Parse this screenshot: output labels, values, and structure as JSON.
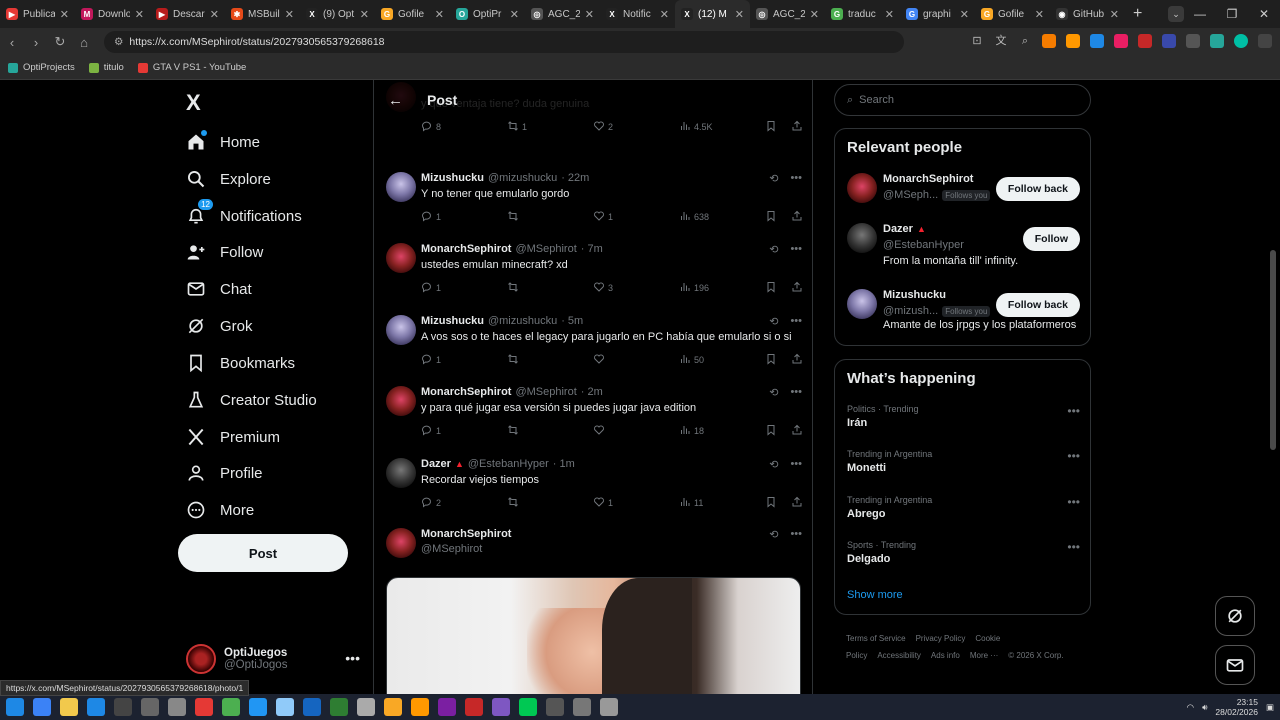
{
  "browser": {
    "tabs": [
      {
        "label": "Publica",
        "color": "#e53935",
        "glyph": "▶"
      },
      {
        "label": "Downlo",
        "color": "#c2185b",
        "glyph": "M"
      },
      {
        "label": "Descar",
        "color": "#b71c1c",
        "glyph": "▶"
      },
      {
        "label": "MSBuil",
        "color": "#e64a19",
        "glyph": "✱"
      },
      {
        "label": "(9) Opt",
        "color": "#222",
        "glyph": "X"
      },
      {
        "label": "Gofile",
        "color": "#f9a825",
        "glyph": "G"
      },
      {
        "label": "OptiPr",
        "color": "#26a69a",
        "glyph": "O"
      },
      {
        "label": "AGC_2",
        "color": "#555",
        "glyph": "◎"
      },
      {
        "label": "Notific",
        "color": "#222",
        "glyph": "X"
      },
      {
        "label": "(12) M",
        "color": "#222",
        "glyph": "X"
      },
      {
        "label": "AGC_2",
        "color": "#555",
        "glyph": "◎"
      },
      {
        "label": "traduc",
        "color": "#4caf50",
        "glyph": "G"
      },
      {
        "label": "graphi",
        "color": "#4285f4",
        "glyph": "G"
      },
      {
        "label": "Gofile",
        "color": "#f9a825",
        "glyph": "G"
      },
      {
        "label": "GitHub",
        "color": "#333",
        "glyph": "◉"
      }
    ],
    "active_tab_index": 9,
    "url": "https://x.com/MSephirot/status/2027930565379268618",
    "bookmarks": [
      {
        "label": "OptiProjects",
        "color": "#26a69a"
      },
      {
        "label": "titulo",
        "color": "#7cb342"
      },
      {
        "label": "GTA V PS1 - YouTube",
        "color": "#e53935"
      }
    ],
    "status_url": "https://x.com/MSephirot/status/2027930565379268618/photo/1"
  },
  "nav": {
    "logo": "X",
    "items": [
      {
        "label": "Home",
        "icon": "home-icon"
      },
      {
        "label": "Explore",
        "icon": "search-icon"
      },
      {
        "label": "Notifications",
        "icon": "bell-icon",
        "badge": "12"
      },
      {
        "label": "Follow",
        "icon": "person-plus-icon"
      },
      {
        "label": "Chat",
        "icon": "mail-icon"
      },
      {
        "label": "Grok",
        "icon": "grok-icon"
      },
      {
        "label": "Bookmarks",
        "icon": "bookmark-icon"
      },
      {
        "label": "Creator Studio",
        "icon": "creator-icon"
      },
      {
        "label": "Premium",
        "icon": "x-icon"
      },
      {
        "label": "Profile",
        "icon": "profile-icon"
      },
      {
        "label": "More",
        "icon": "more-circle-icon"
      }
    ],
    "post_button": "Post",
    "account": {
      "name": "OptiJuegos",
      "handle": "@OptiJogos"
    }
  },
  "header": {
    "title": "Post"
  },
  "tweets": [
    {
      "name": "",
      "handle": "",
      "time": "",
      "text": "y qué ventaja tiene? duda genuina",
      "replies": "8",
      "reposts": "1",
      "likes": "2",
      "views": "4.5K",
      "avatar": "m",
      "partial": true
    },
    {
      "name": "Mizushucku",
      "handle": "@mizushucku",
      "time": "· 22m",
      "text": "Y no tener que emularlo gordo",
      "replies": "1",
      "reposts": "",
      "likes": "1",
      "views": "638",
      "avatar": "z"
    },
    {
      "name": "MonarchSephirot",
      "handle": "@MSephirot",
      "time": "· 7m",
      "text": "ustedes emulan minecraft? xd",
      "replies": "1",
      "reposts": "",
      "likes": "3",
      "views": "196",
      "avatar": "m"
    },
    {
      "name": "Mizushucku",
      "handle": "@mizushucku",
      "time": "· 5m",
      "text": "A vos sos o te haces el legacy para jugarlo en PC había que emularlo si o si",
      "replies": "1",
      "reposts": "",
      "likes": "",
      "views": "50",
      "avatar": "z"
    },
    {
      "name": "MonarchSephirot",
      "handle": "@MSephirot",
      "time": "· 2m",
      "text": "y para qué jugar esa versión si puedes jugar java edition",
      "replies": "1",
      "reposts": "",
      "likes": "",
      "views": "18",
      "avatar": "m"
    },
    {
      "name": "Dazer",
      "handle": "@EstebanHyper",
      "time": "· 1m",
      "text": "Recordar viejos tiempos",
      "replies": "2",
      "reposts": "",
      "likes": "1",
      "views": "11",
      "avatar": "d",
      "flag": "▲"
    }
  ],
  "last_tweet": {
    "name": "MonarchSephirot",
    "handle": "@MSephirot"
  },
  "right": {
    "search_placeholder": "Search",
    "relevant_title": "Relevant people",
    "people": [
      {
        "name": "MonarchSephirot",
        "handle": "@MSeph...",
        "follows_you": "Follows you",
        "button": "Follow back",
        "bio": "",
        "avatar": "m"
      },
      {
        "name": "Dazer",
        "flag": "▲",
        "handle": "@EstebanHyper",
        "follows_you": "",
        "button": "Follow",
        "bio": "From la montaña till' infinity.",
        "avatar": "d"
      },
      {
        "name": "Mizushucku",
        "handle": "@mizush...",
        "follows_you": "Follows you",
        "button": "Follow back",
        "bio": "Amante de los jrpgs y los plataformeros",
        "avatar": "z"
      }
    ],
    "happening_title": "What’s happening",
    "trends": [
      {
        "context": "Politics · Trending",
        "title": "Irán"
      },
      {
        "context": "Trending in Argentina",
        "title": "Monetti"
      },
      {
        "context": "Trending in Argentina",
        "title": "Abrego"
      },
      {
        "context": "Sports · Trending",
        "title": "Delgado"
      }
    ],
    "show_more": "Show more",
    "footer": [
      "Terms of Service",
      "Privacy Policy",
      "Cookie Policy",
      "Accessibility",
      "Ads info",
      "More ···",
      "© 2026 X Corp."
    ]
  },
  "taskbar": {
    "time": "23:15",
    "date": "28/02/2026",
    "icons": [
      "#3b82f6",
      "#f2c94c",
      "#1e88e5",
      "#444",
      "#666",
      "#888",
      "#e53935",
      "#4caf50",
      "#2196f3",
      "#90caf9",
      "#1565c0",
      "#2e7d32",
      "#aaa",
      "#f9a825",
      "#ff9800",
      "#7b1fa2",
      "#c62828",
      "#7e57c2",
      "#00c853",
      "#555",
      "#777",
      "#999"
    ]
  }
}
